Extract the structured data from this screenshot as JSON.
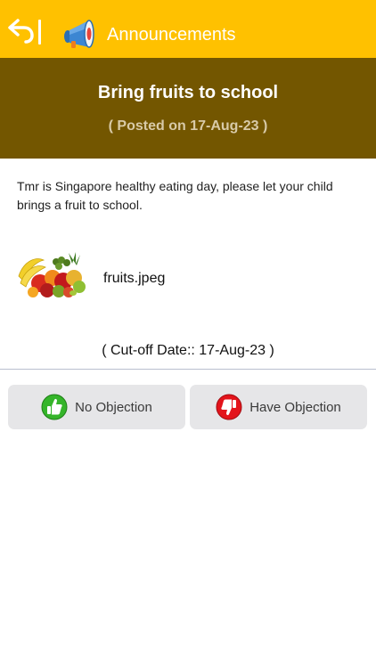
{
  "header": {
    "title": "Announcements",
    "back_icon": "back-arrow-icon",
    "megaphone_icon": "megaphone-icon",
    "bg_color": "#ffc100"
  },
  "announcement": {
    "title": "Bring fruits to school",
    "posted": "( Posted on 17-Aug-23 )",
    "banner_color": "#735600",
    "message": "Tmr is Singapore healthy eating day, please let your child brings a fruit to school."
  },
  "attachment": {
    "filename": "fruits.jpeg"
  },
  "cutoff": {
    "text": "( Cut-off Date:: 17-Aug-23 )"
  },
  "actions": {
    "no_objection": "No Objection",
    "have_objection": "Have Objection",
    "no_color": "#35b52a",
    "have_color": "#e3141b"
  }
}
